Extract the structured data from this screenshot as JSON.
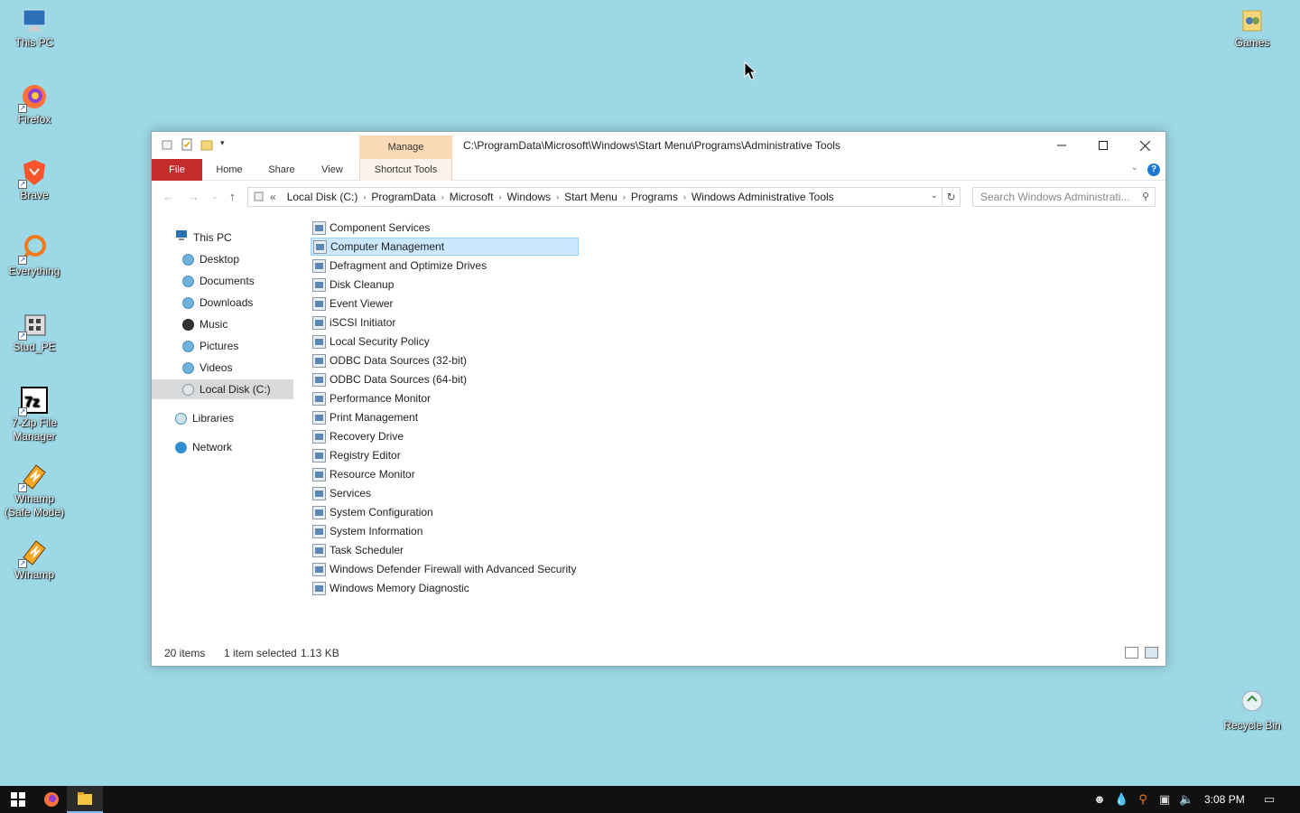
{
  "desktop": {
    "icons_left": [
      {
        "label": "This PC",
        "icon": "this-pc-icon"
      },
      {
        "label": "Firefox",
        "icon": "firefox-icon"
      },
      {
        "label": "Brave",
        "icon": "brave-icon"
      },
      {
        "label": "Everything",
        "icon": "everything-icon"
      },
      {
        "label": "Stud_PE",
        "icon": "stud-pe-icon"
      },
      {
        "label": "7-Zip File Manager",
        "icon": "7zip-icon"
      },
      {
        "label": "Winamp (Safe Mode)",
        "icon": "winamp-safe-icon"
      },
      {
        "label": "Winamp",
        "icon": "winamp-icon"
      }
    ],
    "games": "Games",
    "recycle_bin": "Recycle Bin"
  },
  "window": {
    "title_path": "C:\\ProgramData\\Microsoft\\Windows\\Start Menu\\Programs\\Administrative Tools",
    "context_tab": "Manage",
    "ribbon_tabs": {
      "file": "File",
      "home": "Home",
      "share": "Share",
      "view": "View",
      "shortcut_tools": "Shortcut Tools"
    },
    "address": {
      "prefix": "«",
      "segments": [
        "Local Disk (C:)",
        "ProgramData",
        "Microsoft",
        "Windows",
        "Start Menu",
        "Programs",
        "Windows Administrative Tools"
      ]
    },
    "search_placeholder": "Search Windows Administrati...",
    "nav": {
      "this_pc": "This PC",
      "desktop": "Desktop",
      "documents": "Documents",
      "downloads": "Downloads",
      "music": "Music",
      "pictures": "Pictures",
      "videos": "Videos",
      "local_disk": "Local Disk (C:)",
      "libraries": "Libraries",
      "network": "Network"
    },
    "files": [
      "Component Services",
      "Computer Management",
      "Defragment and Optimize Drives",
      "Disk Cleanup",
      "Event Viewer",
      "iSCSI Initiator",
      "Local Security Policy",
      "ODBC Data Sources (32-bit)",
      "ODBC Data Sources (64-bit)",
      "Performance Monitor",
      "Print Management",
      "Recovery Drive",
      "Registry Editor",
      "Resource Monitor",
      "Services",
      "System Configuration",
      "System Information",
      "Task Scheduler",
      "Windows Defender Firewall with Advanced Security",
      "Windows Memory Diagnostic"
    ],
    "selected_file": "Computer Management",
    "status": {
      "count": "20 items",
      "selected": "1 item selected",
      "size": "1.13 KB"
    }
  },
  "taskbar": {
    "clock": "3:08 PM"
  },
  "colors": {
    "desktop_bg": "#9dd8e6",
    "file_tab": "#c42b2b",
    "manage_tab": "#f9d9b6",
    "selection": "#cce8ff"
  }
}
